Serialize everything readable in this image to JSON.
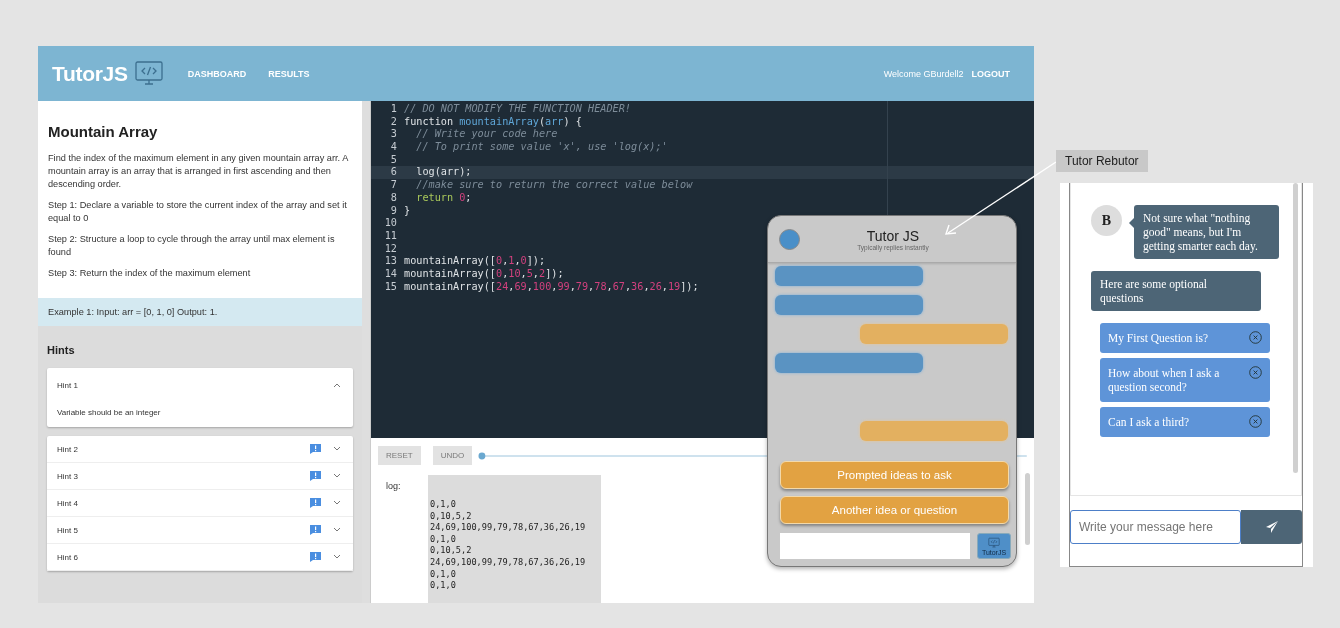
{
  "header": {
    "brand": "TutorJS",
    "nav": [
      {
        "label": "DASHBOARD"
      },
      {
        "label": "RESULTS"
      }
    ],
    "welcome": "Welcome GBurdell2",
    "logout": "LOGOUT"
  },
  "problem": {
    "title": "Mountain Array",
    "paragraphs": [
      "Find the index of the maximum element in any given mountain array arr. A mountain array is an array that is arranged in first ascending and then descending order.",
      "Step 1: Declare a variable to store the current index of the array and set it equal to 0",
      "Step 2: Structure a loop to cycle through the array until max element is found",
      "Step 3: Return the index of the maximum element"
    ],
    "example": "Example 1: Input: arr = [0, 1, 0] Output: 1."
  },
  "hints": {
    "title": "Hints",
    "items": [
      {
        "title": "Hint 1",
        "expanded": true,
        "flagged": false,
        "body": "Variable should be an integer"
      },
      {
        "title": "Hint 2",
        "expanded": false,
        "flagged": true
      },
      {
        "title": "Hint 3",
        "expanded": false,
        "flagged": true
      },
      {
        "title": "Hint 4",
        "expanded": false,
        "flagged": true
      },
      {
        "title": "Hint 5",
        "expanded": false,
        "flagged": true
      },
      {
        "title": "Hint 6",
        "expanded": false,
        "flagged": true
      }
    ]
  },
  "editor": {
    "lines": [
      {
        "number": "1",
        "active": false,
        "tokens": [
          {
            "text": "// DO NOT MODIFY THE FUNCTION HEADER!",
            "kind": "comment"
          }
        ]
      },
      {
        "number": "2",
        "active": false,
        "tokens": [
          {
            "text": "function ",
            "kind": "plain"
          },
          {
            "text": "mountainArray",
            "kind": "name"
          },
          {
            "text": "(",
            "kind": "plain"
          },
          {
            "text": "arr",
            "kind": "name"
          },
          {
            "text": ") {",
            "kind": "plain"
          }
        ]
      },
      {
        "number": "3",
        "active": false,
        "tokens": [
          {
            "text": "  // Write your code here",
            "kind": "comment"
          }
        ]
      },
      {
        "number": "4",
        "active": false,
        "tokens": [
          {
            "text": "  // To print some value 'x', use 'log(x);'",
            "kind": "comment"
          }
        ]
      },
      {
        "number": "5",
        "active": false
      },
      {
        "number": "6",
        "active": true,
        "tokens": [
          {
            "text": "  log(arr);",
            "kind": "plain"
          }
        ]
      },
      {
        "number": "7",
        "active": false,
        "tokens": [
          {
            "text": "  //make sure to return the correct value below",
            "kind": "comment"
          }
        ]
      },
      {
        "number": "8",
        "active": false,
        "tokens": [
          {
            "text": "  return ",
            "kind": "keyword"
          },
          {
            "text": "0",
            "kind": "number"
          },
          {
            "text": ";",
            "kind": "plain"
          }
        ]
      },
      {
        "number": "9",
        "active": false,
        "tokens": [
          {
            "text": "}",
            "kind": "plain"
          }
        ]
      },
      {
        "number": "10",
        "active": false
      },
      {
        "number": "11",
        "active": false
      },
      {
        "number": "12",
        "active": false
      },
      {
        "number": "13",
        "active": false,
        "tokens": [
          {
            "text": "mountainArray([",
            "kind": "plain"
          },
          {
            "text": "0",
            "kind": "number"
          },
          {
            "text": ",",
            "kind": "plain"
          },
          {
            "text": "1",
            "kind": "number"
          },
          {
            "text": ",",
            "kind": "plain"
          },
          {
            "text": "0",
            "kind": "number"
          },
          {
            "text": "]);",
            "kind": "plain"
          }
        ]
      },
      {
        "number": "14",
        "active": false,
        "tokens": [
          {
            "text": "mountainArray([",
            "kind": "plain"
          },
          {
            "text": "0",
            "kind": "number"
          },
          {
            "text": ",",
            "kind": "plain"
          },
          {
            "text": "10",
            "kind": "number"
          },
          {
            "text": ",",
            "kind": "plain"
          },
          {
            "text": "5",
            "kind": "number"
          },
          {
            "text": ",",
            "kind": "plain"
          },
          {
            "text": "2",
            "kind": "number"
          },
          {
            "text": "]);",
            "kind": "plain"
          }
        ]
      },
      {
        "number": "15",
        "active": false,
        "tokens": [
          {
            "text": "mountainArray([",
            "kind": "plain"
          },
          {
            "text": "24",
            "kind": "number"
          },
          {
            "text": ",",
            "kind": "plain"
          },
          {
            "text": "69",
            "kind": "number"
          },
          {
            "text": ",",
            "kind": "plain"
          },
          {
            "text": "100",
            "kind": "number"
          },
          {
            "text": ",",
            "kind": "plain"
          },
          {
            "text": "99",
            "kind": "number"
          },
          {
            "text": ",",
            "kind": "plain"
          },
          {
            "text": "79",
            "kind": "number"
          },
          {
            "text": ",",
            "kind": "plain"
          },
          {
            "text": "78",
            "kind": "number"
          },
          {
            "text": ",",
            "kind": "plain"
          },
          {
            "text": "67",
            "kind": "number"
          },
          {
            "text": ",",
            "kind": "plain"
          },
          {
            "text": "36",
            "kind": "number"
          },
          {
            "text": ",",
            "kind": "plain"
          },
          {
            "text": "26",
            "kind": "number"
          },
          {
            "text": ",",
            "kind": "plain"
          },
          {
            "text": "19",
            "kind": "number"
          },
          {
            "text": "]);",
            "kind": "plain"
          }
        ]
      }
    ]
  },
  "toolbar": {
    "buttons": [
      {
        "label": "RESET"
      },
      {
        "label": "UNDO"
      }
    ],
    "slider": {
      "level": 0
    }
  },
  "log": {
    "label": "log:",
    "lines": [
      "0,1,0",
      "0,10,5,2",
      "24,69,100,99,79,78,67,36,26,19",
      "0,1,0",
      "0,10,5,2",
      "24,69,100,99,79,78,67,36,26,19",
      "0,1,0",
      "0,1,0"
    ]
  },
  "chat_popup": {
    "title": "Tutor JS",
    "subtitle": "Typically replies instantly",
    "bubbles": [
      {
        "kind": "bot"
      },
      {
        "kind": "bot"
      },
      {
        "kind": "user"
      },
      {
        "kind": "bot"
      },
      {
        "kind": "gap"
      },
      {
        "kind": "user"
      }
    ],
    "buttons": [
      {
        "label": "Prompted ideas to ask"
      },
      {
        "label": "Another idea or question"
      }
    ],
    "send_label": "TutorJS"
  },
  "inset": {
    "caption": "Tutor Rebutor",
    "messages": [
      {
        "kind": "bot",
        "avatar": "B",
        "text": "Not sure what \"nothing good\" means, but I'm getting smarter each day."
      },
      {
        "kind": "note",
        "text": "Here are some optional questions"
      }
    ],
    "suggestions": [
      {
        "text": "My First Question is?"
      },
      {
        "text": "How about when I ask a question second?"
      },
      {
        "text": "Can I ask a third?"
      }
    ],
    "placeholder": "Write your message here"
  }
}
